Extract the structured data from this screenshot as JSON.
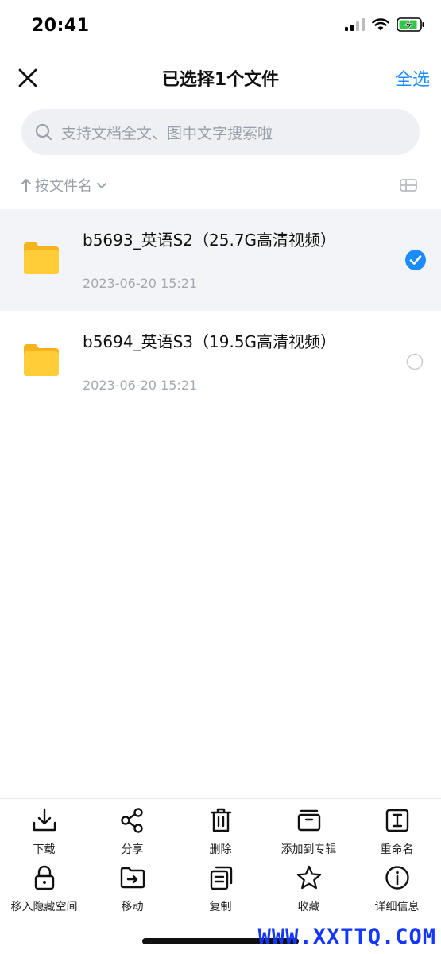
{
  "status_bar": {
    "time": "20:41"
  },
  "header": {
    "title": "已选择1个文件",
    "select_all": "全选"
  },
  "search": {
    "placeholder": "支持文档全文、图中文字搜索啦"
  },
  "sort": {
    "label": "按文件名"
  },
  "files": [
    {
      "name": "b5693_英语S2（25.7G高清视频）",
      "date": "2023-06-20 15:21",
      "selected": true
    },
    {
      "name": "b5694_英语S3（19.5G高清视频）",
      "date": "2023-06-20 15:21",
      "selected": false
    }
  ],
  "toolbar": {
    "row1": [
      {
        "icon": "download-icon",
        "label": "下载"
      },
      {
        "icon": "share-icon",
        "label": "分享"
      },
      {
        "icon": "trash-icon",
        "label": "删除"
      },
      {
        "icon": "album-icon",
        "label": "添加到专辑"
      },
      {
        "icon": "rename-icon",
        "label": "重命名"
      }
    ],
    "row2": [
      {
        "icon": "lock-icon",
        "label": "移入隐藏空间"
      },
      {
        "icon": "move-icon",
        "label": "移动"
      },
      {
        "icon": "copy-icon",
        "label": "复制"
      },
      {
        "icon": "star-icon",
        "label": "收藏"
      },
      {
        "icon": "info-icon",
        "label": "详细信息"
      }
    ]
  },
  "watermark": "WWW.XXTTQ.COM",
  "colors": {
    "accent": "#1a8cff",
    "folder": "#ffc933",
    "selected_bg": "#f3f4f7"
  }
}
